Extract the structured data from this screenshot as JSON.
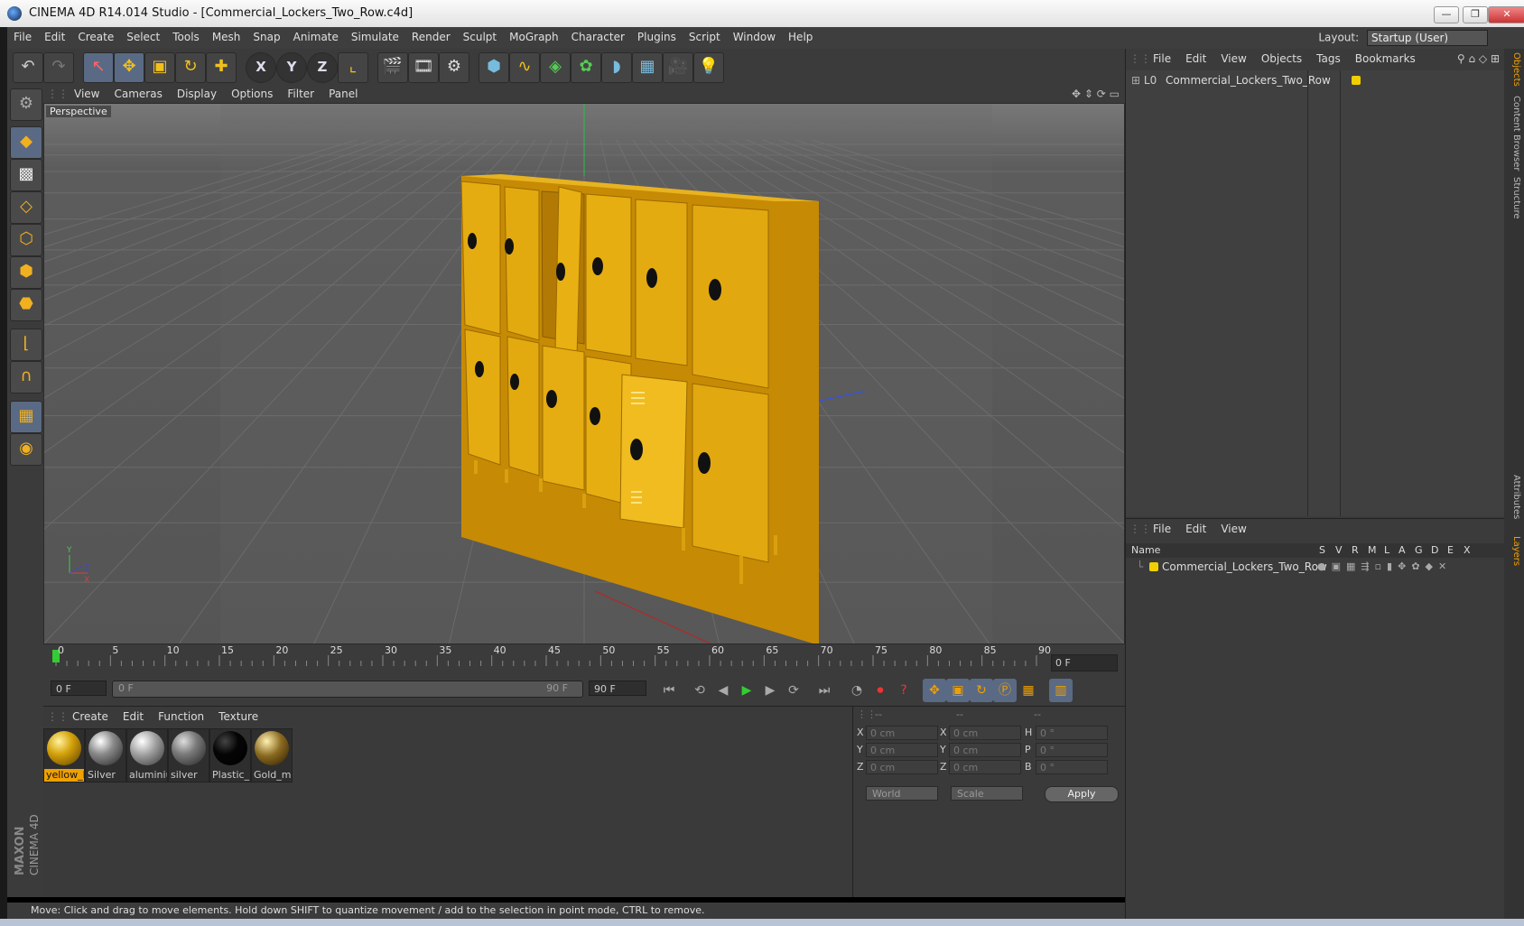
{
  "window": {
    "title": "CINEMA 4D R14.014 Studio - [Commercial_Lockers_Two_Row.c4d]"
  },
  "menubar": {
    "items": [
      "File",
      "Edit",
      "Create",
      "Select",
      "Tools",
      "Mesh",
      "Snap",
      "Animate",
      "Simulate",
      "Render",
      "Sculpt",
      "MoGraph",
      "Character",
      "Plugins",
      "Script",
      "Window",
      "Help"
    ],
    "layout_label": "Layout:",
    "layout_value": "Startup (User)"
  },
  "viewport": {
    "menu": [
      "View",
      "Cameras",
      "Display",
      "Options",
      "Filter",
      "Panel"
    ],
    "label": "Perspective"
  },
  "timeline": {
    "ticks": [
      "0",
      "5",
      "10",
      "15",
      "20",
      "25",
      "30",
      "35",
      "40",
      "45",
      "50",
      "55",
      "60",
      "65",
      "70",
      "75",
      "80",
      "85",
      "90"
    ],
    "current_frame": "0 F"
  },
  "transport": {
    "start_field": "0 F",
    "range_left": "0 F",
    "range_right": "90 F",
    "end_field": "90 F"
  },
  "materials": {
    "menu": [
      "Create",
      "Edit",
      "Function",
      "Texture"
    ],
    "items": [
      {
        "label": "yellow_l",
        "color": "#d4a20a"
      },
      {
        "label": "Silver",
        "color": "#8a8a8a"
      },
      {
        "label": "aluminiu",
        "color": "#9a9a9a"
      },
      {
        "label": "silver",
        "color": "#7a7a7a"
      },
      {
        "label": "Plastic_l",
        "color": "#050505"
      },
      {
        "label": "Gold_m",
        "color": "#8a6a20"
      }
    ]
  },
  "coordinates": {
    "headers": [
      "--",
      "--",
      "--"
    ],
    "rows": [
      {
        "a": "X",
        "av": "0 cm",
        "b": "X",
        "bv": "0 cm",
        "c": "H",
        "cv": "0 °"
      },
      {
        "a": "Y",
        "av": "0 cm",
        "b": "Y",
        "bv": "0 cm",
        "c": "P",
        "cv": "0 °"
      },
      {
        "a": "Z",
        "av": "0 cm",
        "b": "Z",
        "bv": "0 cm",
        "c": "B",
        "cv": "0 °"
      }
    ],
    "world": "World",
    "scale": "Scale",
    "apply": "Apply"
  },
  "objects": {
    "menu": [
      "File",
      "Edit",
      "View",
      "Objects",
      "Tags",
      "Bookmarks"
    ],
    "item": "Commercial_Lockers_Two_Row"
  },
  "layers": {
    "menu": [
      "File",
      "Edit",
      "View"
    ],
    "headers": [
      "Name",
      "S",
      "V",
      "R",
      "M",
      "L",
      "A",
      "G",
      "D",
      "E",
      "X"
    ],
    "item": "Commercial_Lockers_Two_Row"
  },
  "right_tabs": [
    "Objects",
    "Content Browser",
    "Structure",
    "Attributes",
    "Layers"
  ],
  "status": "Move: Click and drag to move elements. Hold down SHIFT to quantize movement / add to the selection in point mode, CTRL to remove.",
  "brand": {
    "maxon": "MAXON",
    "product": "CINEMA 4D"
  },
  "colors": {
    "locker": "#e8ab10",
    "accent_yellow": "#f0d000",
    "bg": "#3b3b3b"
  }
}
